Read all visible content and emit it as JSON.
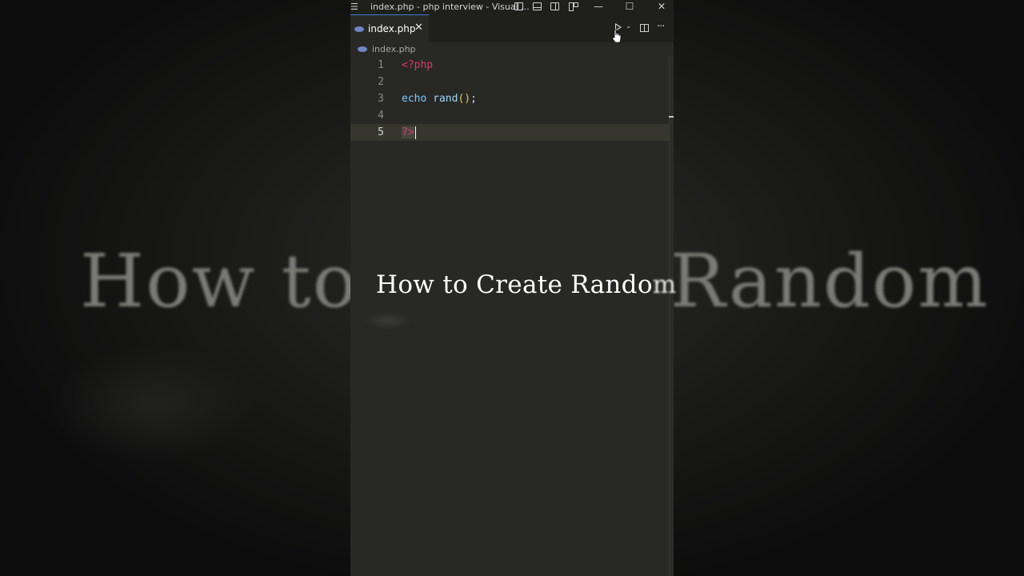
{
  "window": {
    "menu_icon": "hamburger-icon",
    "title": "index.php - php interview - Visual ..."
  },
  "tabs": [
    {
      "label": "index.php",
      "icon": "php-file-icon",
      "close": "✕"
    }
  ],
  "breadcrumb": {
    "file": "index.php"
  },
  "editor": {
    "lines": [
      {
        "number": "1",
        "text": "<?php"
      },
      {
        "number": "2",
        "text": ""
      },
      {
        "number": "3",
        "text": "echo rand();"
      },
      {
        "number": "4",
        "text": ""
      },
      {
        "number": "5",
        "text": "?>"
      }
    ],
    "active_line": "5"
  },
  "caption": {
    "text": "How to Create Rando",
    "tail": "m"
  },
  "background": {
    "caption_text": "How to Create Random"
  },
  "colors": {
    "php_tag": "#e0386b",
    "keyword": "#7ecbff",
    "accent": "#3b7bd4"
  }
}
